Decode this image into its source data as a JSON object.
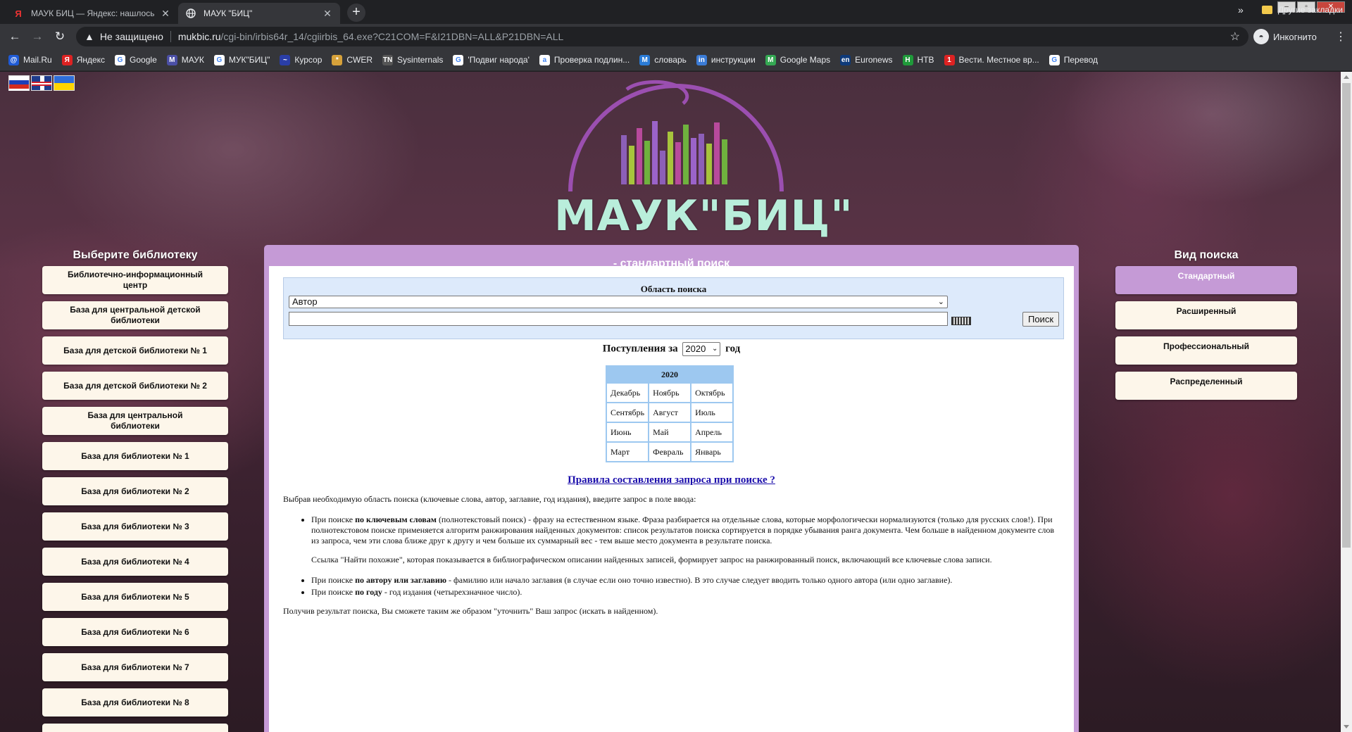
{
  "browser": {
    "tabs": [
      {
        "title": "МАУК БИЦ — Яндекс: нашлось",
        "favicon": "Я",
        "active": false
      },
      {
        "title": "МАУК \"БИЦ\"",
        "favicon": "globe",
        "active": true
      }
    ],
    "new_tab": "+",
    "security_label": "Не защищено",
    "url_host": "mukbic.ru",
    "url_path": "/cgi-bin/irbis64r_14/cgiirbis_64.exe?C21COM=F&I21DBN=ALL&P21DBN=ALL",
    "profile_label": "Инкогнито",
    "bookmarks": [
      {
        "label": "Mail.Ru",
        "color": "#1f5bd6",
        "icon": "@"
      },
      {
        "label": "Яндекс",
        "color": "#d22",
        "icon": "Я"
      },
      {
        "label": "Google",
        "color": "#ffffff",
        "icon": "G"
      },
      {
        "label": "МАУК",
        "color": "#4b4fa5",
        "icon": "M"
      },
      {
        "label": "МУК\"БИЦ\"",
        "color": "#ffffff",
        "icon": "G"
      },
      {
        "label": "Курсор",
        "color": "#2a3ea8",
        "icon": "~"
      },
      {
        "label": "CWER",
        "color": "#d6a13a",
        "icon": "*"
      },
      {
        "label": "Sysinternals",
        "color": "#555",
        "icon": "TN"
      },
      {
        "label": "'Подвиг народа'",
        "color": "#ffffff",
        "icon": "G"
      },
      {
        "label": "Проверка подлин...",
        "color": "#ffffff",
        "icon": "a"
      },
      {
        "label": "словарь",
        "color": "#2a7bd6",
        "icon": "M"
      },
      {
        "label": "инструкции",
        "color": "#3a7bd6",
        "icon": "in"
      },
      {
        "label": "Google Maps",
        "color": "#34a853",
        "icon": "M"
      },
      {
        "label": "Euronews",
        "color": "#0e3a7a",
        "icon": "en"
      },
      {
        "label": "НТВ",
        "color": "#1f9a3a",
        "icon": "H"
      },
      {
        "label": "Вести. Местное вр...",
        "color": "#d22",
        "icon": "1"
      },
      {
        "label": "Перевод",
        "color": "#ffffff",
        "icon": "G"
      }
    ],
    "bookmarks_more": "»",
    "other_bookmarks": "Другие закладки"
  },
  "page": {
    "logo_text": "МАУК\"БИЦ\"",
    "logo_bar_colors": [
      "#8c5fb8",
      "#a7c43c",
      "#b84a9c",
      "#6fb23e",
      "#9b63c9"
    ],
    "libraries_title": "Выберите библиотеку",
    "libraries": [
      "Библиотечно-информационный центр",
      "База для центральной детской библиотеки",
      "База для детской библиотеки № 1",
      "База для детской библиотеки № 2",
      "База для центральной библиотеки",
      "База для библиотеки № 1",
      "База для библиотеки № 2",
      "База для библиотеки № 3",
      "База для библиотеки № 4",
      "База для библиотеки № 5",
      "База для библиотеки № 6",
      "База для библиотеки № 7",
      "База для библиотеки № 8"
    ],
    "search_types_title": "Вид поиска",
    "search_types": [
      {
        "label": "Стандартный",
        "active": true
      },
      {
        "label": "Расширенный",
        "active": false
      },
      {
        "label": "Профессиональный",
        "active": false
      },
      {
        "label": "Распределенный",
        "active": false
      }
    ],
    "main_title": "- стандартный поиск",
    "search": {
      "area_label": "Область поиска",
      "area_selected": "Автор",
      "query_value": "",
      "button": "Поиск"
    },
    "arrivals": {
      "prefix": "Поступления за",
      "year": "2020",
      "suffix": "год"
    },
    "calendar": {
      "header": "2020",
      "rows": [
        [
          "Декабрь",
          "Ноябрь",
          "Октябрь"
        ],
        [
          "Сентябрь",
          "Август",
          "Июль"
        ],
        [
          "Июнь",
          "Май",
          "Апрель"
        ],
        [
          "Март",
          "Февраль",
          "Январь"
        ]
      ]
    },
    "rules_link": "Правила составления запроса при поиске ?",
    "help": {
      "intro": "Выбрав необходимую область поиска (ключевые слова, автор, заглавие, год издания), введите запрос в поле ввода:",
      "kw_prefix": "При поиске ",
      "kw_bold": "по ключевым словам",
      "kw_text": " (полнотекстовый поиск) - фразу на естественном языке. Фраза разбирается на отдельные слова, которые морфологически нормализуются (только для русских слов!). При полнотекстовом поиске применяется алгоритм ранжирования найденных документов: список результатов поиска сортируется в порядке убывания ранга документа. Чем больше в найденном документе слов из запроса, чем эти слова ближе друг к другу и чем больше их суммарный вес - тем выше место документа в результате поиска.",
      "similar": "Ссылка \"Найти похожие\", которая показывается в библиографическом описании найденных записей, формирует запрос на ранжированный поиск, включающий все ключевые слова записи.",
      "author_prefix": "При поиске ",
      "author_bold": "по автору или заглавию",
      "author_text": " - фамилию или начало заглавия (в случае если оно точно известно). В это случае следует вводить только одного автора (или одно заглавие).",
      "year_prefix": "При поиске ",
      "year_bold": "по году",
      "year_text": " - год издания (четырехзначное число).",
      "outro": "Получив результат поиска, Вы сможете таким же образом \"уточнить\" Ваш запрос (искать в найденном)."
    }
  }
}
